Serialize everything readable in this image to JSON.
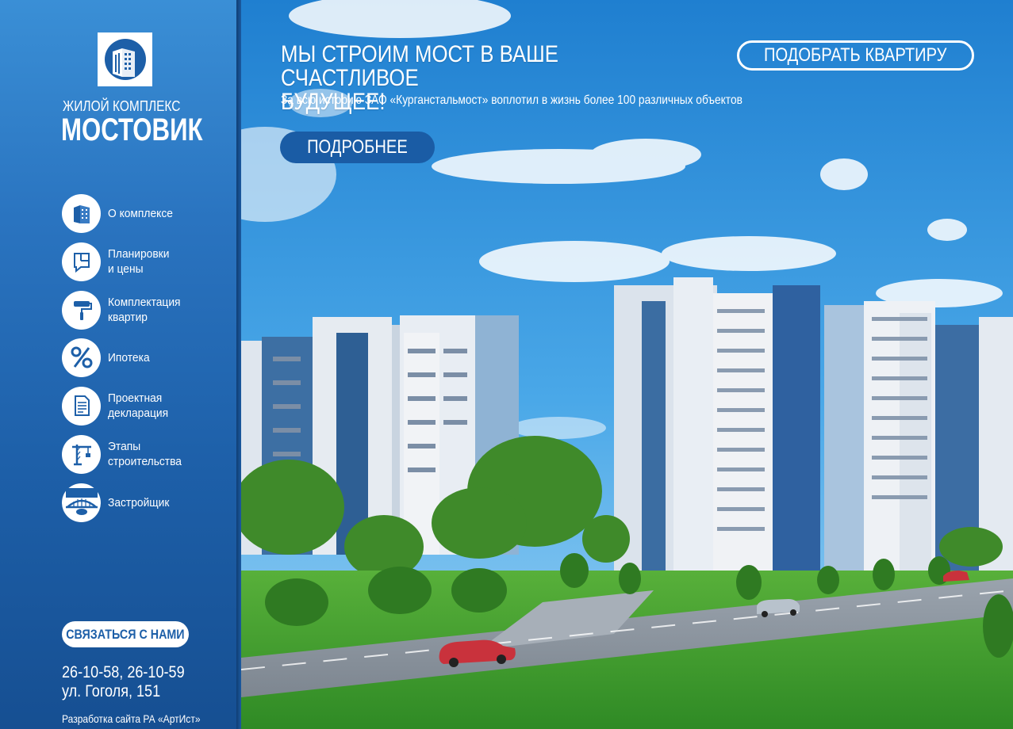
{
  "brand": {
    "subtitle": "ЖИЛОЙ КОМПЛЕКС",
    "name": "МОСТОВИК",
    "logo_icon": "building-logo-icon"
  },
  "nav": {
    "items": [
      {
        "label": "О комплексе",
        "icon": "building-icon"
      },
      {
        "label": "Планировки\nи цены",
        "icon": "floorplan-icon"
      },
      {
        "label": "Комплектация\nквартир",
        "icon": "paint-roller-icon"
      },
      {
        "label": "Ипотека",
        "icon": "percent-icon"
      },
      {
        "label": "Проектная\nдекларация",
        "icon": "document-icon"
      },
      {
        "label": "Этапы\nстроительства",
        "icon": "crane-icon"
      },
      {
        "label": "Застройщик",
        "icon": "bridge-icon"
      }
    ]
  },
  "contact": {
    "button_label": "СВЯЗАТЬСЯ С НАМИ",
    "phones": "26-10-58, 26-10-59",
    "address": "ул. Гоголя, 151",
    "credit": "Разработка сайта РА «АртИст»"
  },
  "hero": {
    "headline": "МЫ СТРОИМ МОСТ В ВАШЕ СЧАСТЛИВОЕ\nБУДУЩЕЕ!",
    "subline": "За всю историю ЗАО «Курганстальмост» воплотил в жизнь более 100 различных объектов",
    "more_label": "ПОДРОБНЕЕ",
    "pick_label": "ПОДОБРАТЬ КВАРТИРУ"
  },
  "colors": {
    "sidebar_top": "#3a8fd6",
    "sidebar_bottom": "#164f92",
    "accent": "#1a5ca5",
    "sky": "#3c9ee4",
    "grass": "#3f9a2e"
  }
}
